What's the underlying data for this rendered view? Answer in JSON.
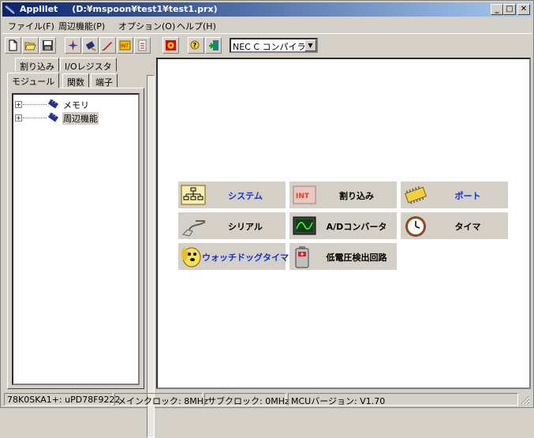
{
  "window": {
    "title": "Applilet",
    "path": "(D:¥mspoon¥test1¥test1.prx)",
    "min_glyph": "_",
    "max_glyph": "□",
    "close_glyph": "✕"
  },
  "menu": [
    {
      "label": "ファイル(F)"
    },
    {
      "label": "周辺機能(P)"
    },
    {
      "label": "オプション(O)"
    },
    {
      "label": "ヘルプ(H)"
    }
  ],
  "toolbar": {
    "icons": [
      "new-file-icon",
      "open-folder-icon",
      "save-icon",
      "compass-icon",
      "chip-icon",
      "pen-icon",
      "int-icon",
      "doc-icon",
      "cd-icon",
      "help-icon",
      "exit-icon"
    ],
    "compiler": {
      "value": "NEC C コンパイラ"
    }
  },
  "left_tabs": {
    "row1": [
      {
        "label": "割り込み"
      },
      {
        "label": "I/Oレジスタ"
      }
    ],
    "row2": [
      {
        "label": "モジュール"
      },
      {
        "label": "関数"
      },
      {
        "label": "端子"
      }
    ],
    "active": "モジュール"
  },
  "tree": [
    {
      "label": "メモリ",
      "expander": "+"
    },
    {
      "label": "周辺機能",
      "expander": "+",
      "selected": true
    }
  ],
  "functions": [
    {
      "label": "システム",
      "icon": "system-diagram-icon",
      "blue": true
    },
    {
      "label": "割り込み",
      "icon": "interrupt-icon",
      "blue": false
    },
    {
      "label": "ポート",
      "icon": "port-chip-icon",
      "blue": true
    },
    {
      "label": "シリアル",
      "icon": "serial-cable-icon",
      "blue": false
    },
    {
      "label": "A/Dコンバータ",
      "icon": "ad-converter-icon",
      "blue": false
    },
    {
      "label": "タイマ",
      "icon": "clock-icon",
      "blue": false
    },
    {
      "label": "ウォッチドッグタイマ",
      "icon": "watchdog-icon",
      "blue": true
    },
    {
      "label": "低電圧検出回路",
      "icon": "battery-icon",
      "blue": false
    }
  ],
  "status": {
    "device": "78K0SKA1+: uPD78F9222",
    "main_clock": "メインクロック: 8MHz",
    "sub_clock": "サブクロック: 0MHz",
    "mcu_version": "MCUバージョン:   V1.70"
  },
  "colors": {
    "title_start": "#0a246a",
    "title_end": "#a6caf0",
    "face": "#d4d0c8",
    "link_blue": "#1030e0"
  }
}
